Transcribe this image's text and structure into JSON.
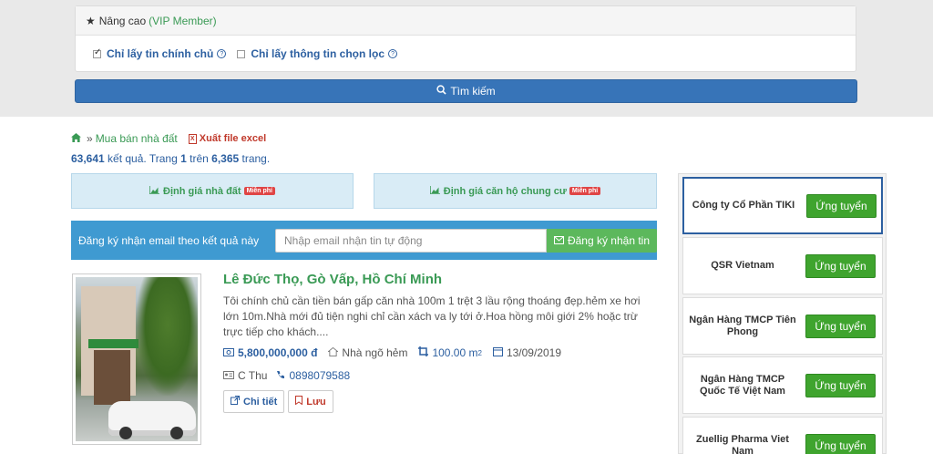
{
  "advanced": {
    "label": "Nâng cao",
    "vip_label": "VIP Member",
    "filters": [
      {
        "label": "Chỉ lấy tin chính chủ",
        "checked": true
      },
      {
        "label": "Chỉ lấy thông tin chọn lọc",
        "checked": false
      }
    ]
  },
  "search": {
    "button_label": "Tìm kiếm"
  },
  "breadcrumb": {
    "item": "Mua bán nhà đất",
    "excel_label": "Xuất file excel"
  },
  "results": {
    "count": "63,641",
    "text1": " kết quả. Trang ",
    "page": "1",
    "text2": " trên ",
    "total_pages": "6,365",
    "text3": " trang."
  },
  "valuation": [
    {
      "label": "Định giá nhà đất",
      "badge": "Miễn phí"
    },
    {
      "label": "Định giá căn hộ chung cư",
      "badge": "Miễn phí"
    }
  ],
  "email_signup": {
    "text": "Đăng ký nhận email theo kết quả này",
    "placeholder": "Nhập email nhận tin tự động",
    "button_label": "Đăng ký nhận tin"
  },
  "listing": {
    "title": "Lê Đức Thọ, Gò Vấp, Hồ Chí Minh",
    "description": "Tôi chính chủ cần tiền bán gấp căn nhà 100m 1 trệt 3 lầu rộng thoáng đẹp.hẻm xe hơi lớn 10m.Nhà mới đủ tiện nghi chỉ cần xách va ly tới ở.Hoa hồng môi giới 2% hoặc trừ trực tiếp cho khách....",
    "price": "5,800,000,000 đ",
    "type": "Nhà ngõ hẻm",
    "area": "100.00 m",
    "area_unit_sup": "2",
    "date": "13/09/2019",
    "contact_name": "C Thu",
    "phone": "0898079588",
    "detail_label": "Chi tiết",
    "save_label": "Lưu"
  },
  "jobs": [
    {
      "company": "Công ty Cổ Phần TIKI",
      "apply_label": "Ứng tuyển"
    },
    {
      "company": "QSR Vietnam",
      "apply_label": "Ứng tuyển"
    },
    {
      "company": "Ngân Hàng TMCP Tiên Phong",
      "apply_label": "Ứng tuyển"
    },
    {
      "company": "Ngân Hàng TMCP Quốc Tế Việt Nam",
      "apply_label": "Ứng tuyển"
    },
    {
      "company": "Zuellig Pharma Viet Nam",
      "apply_label": "Ứng tuyển"
    }
  ],
  "colors": {
    "primary_blue": "#3774b8",
    "green": "#3a9a55",
    "apply_green": "#3fa42e",
    "signup_blue": "#3f9ad1"
  },
  "icons": [
    "star-icon",
    "help-icon",
    "search-icon",
    "home-icon",
    "excel-icon",
    "chart-icon",
    "envelope-icon",
    "camera-icon",
    "home-type-icon",
    "area-icon",
    "calendar-icon",
    "id-card-icon",
    "phone-icon",
    "external-link-icon",
    "bookmark-icon"
  ]
}
